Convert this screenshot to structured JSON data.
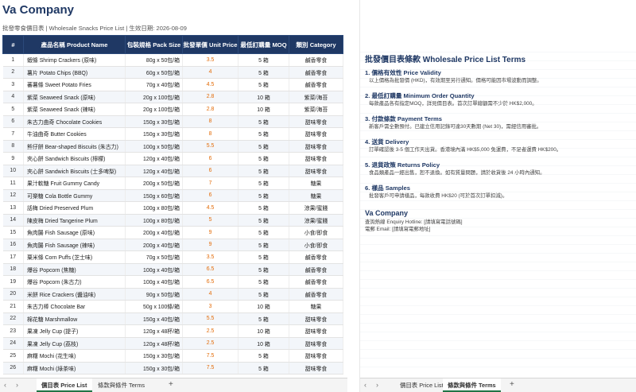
{
  "left": {
    "title": "Va Company",
    "subtitle": "批發零食價目表 | Wholesale Snacks Price List | 生效日期: 2026-08-09",
    "headers": [
      "#",
      "產品名稱 Product Name",
      "包裝規格 Pack Size",
      "批發單價 Unit Price",
      "最低訂購量 MOQ",
      "類別 Category"
    ],
    "rows": [
      [
        "1",
        "蝦條 Shrimp Crackers (原味)",
        "80g x 50包/箱",
        "3.5",
        "5 箱",
        "鹹香零食"
      ],
      [
        "2",
        "薯片 Potato Chips (BBQ)",
        "60g x 50包/箱",
        "4",
        "5 箱",
        "鹹香零食"
      ],
      [
        "3",
        "蕃薯條 Sweet Potato Fries",
        "70g x 40包/箱",
        "4.5",
        "5 箱",
        "鹹香零食"
      ],
      [
        "4",
        "紫菜 Seaweed Snack (原味)",
        "20g x 100包/箱",
        "2.8",
        "10 箱",
        "紫菜/海苔"
      ],
      [
        "5",
        "紫菜 Seaweed Snack (辣味)",
        "20g x 100包/箱",
        "2.8",
        "10 箱",
        "紫菜/海苔"
      ],
      [
        "6",
        "朱古力曲奇 Chocolate Cookies",
        "150g x 30包/箱",
        "8",
        "5 箱",
        "甜味零食"
      ],
      [
        "7",
        "牛油曲奇 Butter Cookies",
        "150g x 30包/箱",
        "8",
        "5 箱",
        "甜味零食"
      ],
      [
        "8",
        "熊仔餅 Bear-shaped Biscuits (朱古力)",
        "100g x 50包/箱",
        "5.5",
        "5 箱",
        "甜味零食"
      ],
      [
        "9",
        "夾心餅 Sandwich Biscuits (檸檬)",
        "120g x 40包/箱",
        "6",
        "5 箱",
        "甜味零食"
      ],
      [
        "10",
        "夾心餅 Sandwich Biscuits (士多啤梨)",
        "120g x 40包/箱",
        "6",
        "5 箱",
        "甜味零食"
      ],
      [
        "11",
        "果汁軟糖 Fruit Gummy Candy",
        "200g x 50包/箱",
        "7",
        "5 箱",
        "糖果"
      ],
      [
        "12",
        "可樂糖 Cola Bottle Gummy",
        "150g x 60包/箱",
        "6",
        "5 箱",
        "糖果"
      ],
      [
        "13",
        "話梅 Dried Preserved Plum",
        "100g x 80包/箱",
        "4.5",
        "5 箱",
        "涼果/蜜餞"
      ],
      [
        "14",
        "陳皮梅 Dried Tangerine Plum",
        "100g x 80包/箱",
        "5",
        "5 箱",
        "涼果/蜜餞"
      ],
      [
        "15",
        "魚肉腸 Fish Sausage (原味)",
        "200g x 40包/箱",
        "9",
        "5 箱",
        "小食/即食"
      ],
      [
        "16",
        "魚肉腸 Fish Sausage (辣味)",
        "200g x 40包/箱",
        "9",
        "5 箱",
        "小食/即食"
      ],
      [
        "17",
        "粟米條 Corn Puffs (芝士味)",
        "70g x 50包/箱",
        "3.5",
        "5 箱",
        "鹹香零食"
      ],
      [
        "18",
        "爆谷 Popcorn (焦糖)",
        "100g x 40包/箱",
        "6.5",
        "5 箱",
        "鹹香零食"
      ],
      [
        "19",
        "爆谷 Popcorn (朱古力)",
        "100g x 40包/箱",
        "6.5",
        "5 箱",
        "鹹香零食"
      ],
      [
        "20",
        "米餅 Rice Crackers (醬油味)",
        "90g x 50包/箱",
        "4",
        "5 箱",
        "鹹香零食"
      ],
      [
        "21",
        "朱古力棒 Chocolate Bar",
        "50g x 100條/箱",
        "3",
        "10 箱",
        "糖果"
      ],
      [
        "22",
        "棉花糖 Marshmallow",
        "150g x 40包/箱",
        "5.5",
        "5 箱",
        "甜味零食"
      ],
      [
        "23",
        "果凍 Jelly Cup (提子)",
        "120g x 48杯/箱",
        "2.5",
        "10 箱",
        "甜味零食"
      ],
      [
        "24",
        "果凍 Jelly Cup (荔枝)",
        "120g x 48杯/箱",
        "2.5",
        "10 箱",
        "甜味零食"
      ],
      [
        "25",
        "麻糬 Mochi (花生味)",
        "150g x 30包/箱",
        "7.5",
        "5 箱",
        "甜味零食"
      ],
      [
        "26",
        "麻糬 Mochi (綠茶味)",
        "150g x 30包/箱",
        "7.5",
        "5 箱",
        "甜味零食"
      ]
    ],
    "tabs": [
      "價目表 Price List",
      "條款與條件 Terms"
    ],
    "active_tab": 0
  },
  "right": {
    "terms_title": "批發價目表條款 Wholesale Price List Terms",
    "terms": [
      {
        "heading": "1. 價格有效性 Price Validity",
        "body": "以上價格為批發價 (HKD)，有效期至另行通知。價格可能因市場波動而調整。"
      },
      {
        "heading": "2. 最低訂購量 Minimum Order Quantity",
        "body": "每款產品各有指定MOQ，詳見價目表。首次訂單總額需不少於 HK$2,000。"
      },
      {
        "heading": "3. 付款條款 Payment Terms",
        "body": "新客戶需全數預付。已建立信用記錄可達30天數期 (Net 30)，需經信用審批。"
      },
      {
        "heading": "4. 送貨 Delivery",
        "body": "訂單確認後 3-5 個工作天出貨。香港境內滿 HK$5,000 免運費，不足者運費 HK$200。"
      },
      {
        "heading": "5. 退貨政策 Returns Policy",
        "body": "食品類產品一經出售，恕不退換。如有質量問題，請於收貨後 24 小時內通知。"
      },
      {
        "heading": "6. 樣品 Samples",
        "body": "批發客戶可申請樣品，每款收費 HK$20 (可於首次訂單扣減)。"
      }
    ],
    "company": "Va Company",
    "hotline": "查詢熱線 Enquiry Hotline: [請填寫電話號碼]",
    "email": "電郵 Email: [請填寫電郵地址]",
    "tabs": [
      "價目表 Price List",
      "條款與條件 Terms"
    ],
    "active_tab": 1
  },
  "colors": {
    "header_bg": "#1f3864",
    "price": "#e36c09",
    "active_tab_underline": "#217346"
  },
  "icons": {
    "prev": "chevron-left-icon",
    "next": "chevron-right-icon",
    "add": "plus-icon"
  }
}
